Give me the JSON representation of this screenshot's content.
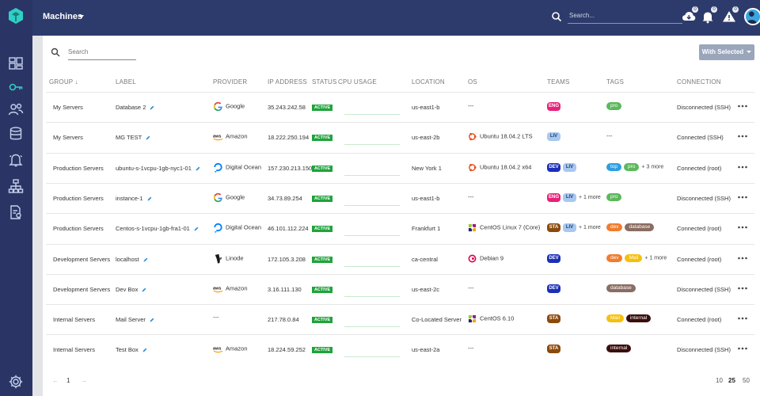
{
  "header": {
    "title": "Machines",
    "search_placeholder": "Search...",
    "notifications": [
      {
        "icon": "cloud-download-icon",
        "count": "0"
      },
      {
        "icon": "bell-icon",
        "count": "0"
      },
      {
        "icon": "warning-icon",
        "count": "0"
      }
    ]
  },
  "sidebar": {
    "items": [
      "dashboard-icon",
      "key-icon",
      "users-icon",
      "database-icon",
      "alerts-icon",
      "org-chart-icon",
      "reports-icon"
    ],
    "footer": "settings-icon"
  },
  "table": {
    "search_placeholder": "Search",
    "with_selected": "With Selected",
    "columns": {
      "group": "GROUP ↓",
      "label": "LABEL",
      "provider": "PROVIDER",
      "ip": "IP ADDRESS",
      "status": "STATUS",
      "cpu": "CPU USAGE",
      "location": "LOCATION",
      "os": "OS",
      "teams": "TEAMS",
      "tags": "TAGS",
      "connection": "CONNECTION"
    },
    "rows": [
      {
        "group": "My Servers",
        "label": "Database 2",
        "provider": "Google",
        "provider_icon": "google",
        "ip": "35.243.242.58",
        "status": "ACTIVE",
        "location": "us-east1-b",
        "os": "---",
        "os_icon": "",
        "teams": [
          {
            "t": "ENG",
            "bg": "#e8217a",
            "fg": "#fff"
          }
        ],
        "teams_more": "",
        "tags": [
          {
            "t": "pro",
            "bg": "#5cb85c"
          }
        ],
        "tags_more": "",
        "tags_dash": "",
        "connection": "Disconnected (SSH)"
      },
      {
        "group": "My Servers",
        "label": "MG TEST",
        "provider": "Amazon",
        "provider_icon": "aws",
        "ip": "18.222.250.194",
        "status": "ACTIVE",
        "location": "us-east-2b",
        "os": "Ubuntu 18.04.2 LTS",
        "os_icon": "ubuntu",
        "teams": [
          {
            "t": "LIV",
            "bg": "#a8c8ef",
            "fg": "#1f3f73"
          }
        ],
        "teams_more": "",
        "tags": [],
        "tags_more": "",
        "tags_dash": "---",
        "connection": "Connected (SSH)"
      },
      {
        "group": "Production Servers",
        "label": "ubuntu-s-1vcpu-1gb-nyc1-01",
        "provider": "Digital Ocean",
        "provider_icon": "do",
        "ip": "157.230.213.150",
        "status": "ACTIVE",
        "location": "New York 1",
        "os": "Ubuntu 18.04.2 x64",
        "os_icon": "ubuntu",
        "teams": [
          {
            "t": "DEV",
            "bg": "#1c2fb8",
            "fg": "#fff"
          },
          {
            "t": "LIV",
            "bg": "#a8c8ef",
            "fg": "#1f3f73"
          }
        ],
        "teams_more": "",
        "tags": [
          {
            "t": "top",
            "bg": "#2d9ee0"
          },
          {
            "t": "pro",
            "bg": "#5cb85c"
          }
        ],
        "tags_more": "+ 3 more",
        "tags_dash": "",
        "connection": "Connected (root)"
      },
      {
        "group": "Production Servers",
        "label": "instance-1",
        "provider": "Google",
        "provider_icon": "google",
        "ip": "34.73.89.254",
        "status": "ACTIVE",
        "location": "us-east1-b",
        "os": "---",
        "os_icon": "",
        "teams": [
          {
            "t": "ENG",
            "bg": "#e8217a",
            "fg": "#fff"
          },
          {
            "t": "LIV",
            "bg": "#a8c8ef",
            "fg": "#1f3f73"
          }
        ],
        "teams_more": "+ 1 more",
        "tags": [
          {
            "t": "pro",
            "bg": "#5cb85c"
          }
        ],
        "tags_more": "",
        "tags_dash": "",
        "connection": "Disconnected (SSH)"
      },
      {
        "group": "Production Servers",
        "label": "Centos-s-1vcpu-1gb-fra1-01",
        "provider": "Digital Ocean",
        "provider_icon": "do",
        "ip": "46.101.112.224",
        "status": "ACTIVE",
        "location": "Frankfurt 1",
        "os": "CentOS Linux 7 (Core)",
        "os_icon": "centos",
        "teams": [
          {
            "t": "STA",
            "bg": "#8b4a0c",
            "fg": "#fff"
          },
          {
            "t": "LIV",
            "bg": "#a8c8ef",
            "fg": "#1f3f73"
          }
        ],
        "teams_more": "+ 1 more",
        "tags": [
          {
            "t": "dev",
            "bg": "#f07c2e"
          },
          {
            "t": "database",
            "bg": "#8a6d62"
          }
        ],
        "tags_more": "",
        "tags_dash": "",
        "connection": "Connected (root)"
      },
      {
        "group": "Development Servers",
        "label": "localhost",
        "provider": "Linode",
        "provider_icon": "linode",
        "ip": "172.105.3.208",
        "status": "ACTIVE",
        "location": "ca-central",
        "os": "Debian 9",
        "os_icon": "debian",
        "teams": [
          {
            "t": "DEV",
            "bg": "#1c2fb8",
            "fg": "#fff"
          }
        ],
        "teams_more": "",
        "tags": [
          {
            "t": "dev",
            "bg": "#f07c2e"
          },
          {
            "t": "Mail",
            "bg": "#f4c010"
          }
        ],
        "tags_more": "+ 1 more",
        "tags_dash": "",
        "connection": "Connected (root)"
      },
      {
        "group": "Development Servers",
        "label": "Dev Box",
        "provider": "Amazon",
        "provider_icon": "aws",
        "ip": "3.16.111.130",
        "status": "ACTIVE",
        "location": "us-east-2c",
        "os": "---",
        "os_icon": "",
        "teams": [
          {
            "t": "DEV",
            "bg": "#1c2fb8",
            "fg": "#fff"
          }
        ],
        "teams_more": "",
        "tags": [
          {
            "t": "database",
            "bg": "#8a6d62"
          }
        ],
        "tags_more": "",
        "tags_dash": "",
        "connection": "Disconnected (SSH)"
      },
      {
        "group": "Internal Servers",
        "label": "Mail Server",
        "provider": "---",
        "provider_icon": "",
        "ip": "217.78.0.84",
        "status": "ACTIVE",
        "location": "Co-Located Server",
        "os": "CentOS 6.10",
        "os_icon": "centos",
        "teams": [
          {
            "t": "STA",
            "bg": "#8b4a0c",
            "fg": "#fff"
          }
        ],
        "teams_more": "",
        "tags": [
          {
            "t": "Mail",
            "bg": "#f4c010"
          },
          {
            "t": "internal",
            "bg": "#3a0d0d"
          }
        ],
        "tags_more": "",
        "tags_dash": "",
        "connection": "Connected (root)"
      },
      {
        "group": "Internal Servers",
        "label": "Test Box",
        "provider": "Amazon",
        "provider_icon": "aws",
        "ip": "18.224.59.252",
        "status": "ACTIVE",
        "location": "us-east-2a",
        "os": "---",
        "os_icon": "",
        "teams": [
          {
            "t": "STA",
            "bg": "#8b4a0c",
            "fg": "#fff"
          }
        ],
        "teams_more": "",
        "tags": [
          {
            "t": "internal",
            "bg": "#3a0d0d"
          }
        ],
        "tags_more": "",
        "tags_dash": "",
        "connection": "Disconnected (SSH)"
      }
    ]
  },
  "pagination": {
    "prev": "←",
    "page": "1",
    "next": "→",
    "sizes": [
      "10",
      "25",
      "50"
    ],
    "selected_size": "25"
  },
  "colors": {
    "sidebar": "#2a3566",
    "header": "#2d3b6c",
    "logo": "#2fd0c6",
    "active": "#1fa33b"
  }
}
